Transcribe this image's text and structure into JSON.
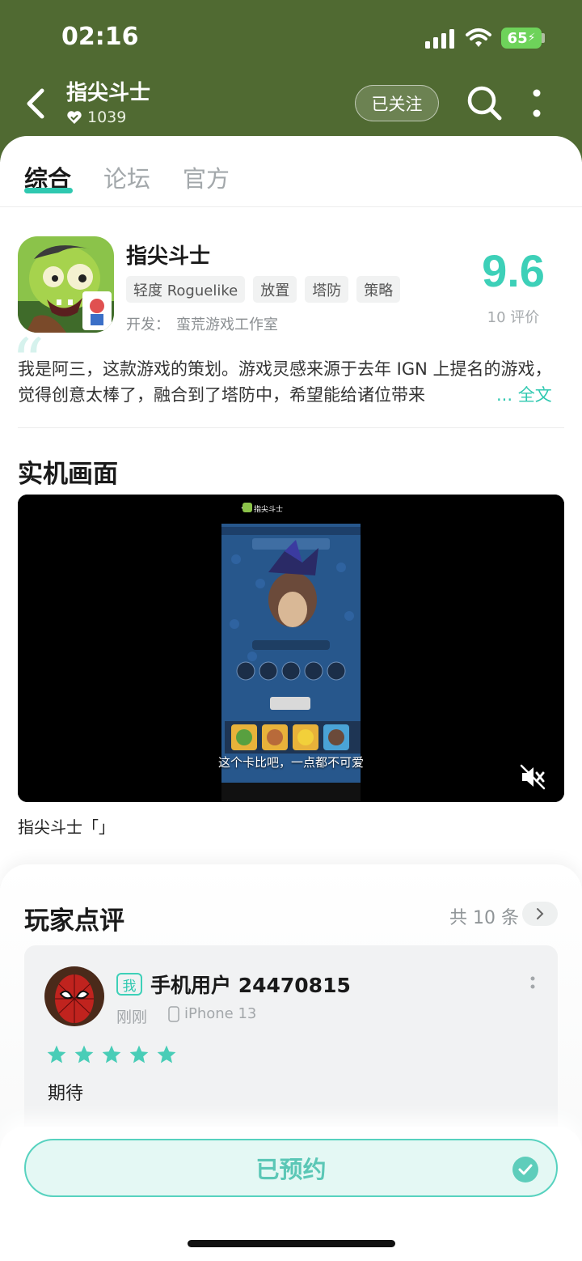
{
  "status_bar": {
    "time": "02:16",
    "battery": "65"
  },
  "header": {
    "title": "指尖斗士",
    "follower_count": "1039",
    "follow_label": "已关注",
    "icons": [
      "back-icon",
      "verified-heart-icon",
      "search-icon",
      "more-vertical-icon"
    ]
  },
  "tabs": [
    "综合",
    "论坛",
    "官方"
  ],
  "app": {
    "name": "指尖斗士",
    "tags": [
      "轻度 Roguelike",
      "放置",
      "塔防",
      "策略"
    ],
    "developer_label": "开发：",
    "developer": "蛮荒游戏工作室",
    "rating": "9.6",
    "rating_count": "10 评价",
    "description": "我是阿三，这款游戏的策划。游戏灵感来源于去年 IGN 上提名的游戏，觉得创意太棒了，融合到了塔防中，希望能给诸位带来",
    "more_label": "... 全文"
  },
  "media": {
    "section_title": "实机画面",
    "video_subtitle": "这个卡比吧，一点都不可爱",
    "video_title_inner": "指尖斗士",
    "caption": "指尖斗士「」",
    "icons": [
      "mute-icon"
    ]
  },
  "reviews": {
    "title": "玩家点评",
    "total": "共 10 条",
    "items": [
      {
        "badge": "我",
        "user": "手机用户 24470815",
        "time": "刚刚",
        "device": "iPhone 13",
        "stars": 5,
        "text": "期待"
      }
    ]
  },
  "bottom": {
    "reserve_label": "已预约"
  },
  "colors": {
    "header_bg": "#506a32",
    "accent": "#3dd0b8",
    "reserve_bg": "#e4f8f4"
  }
}
